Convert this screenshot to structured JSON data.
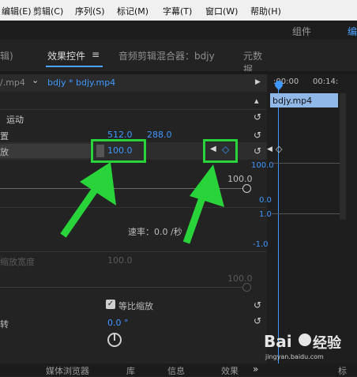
{
  "menu": {
    "items": [
      "编辑(E)",
      "剪辑(C)",
      "序列(S)",
      "标记(M)",
      "字幕(T)",
      "窗口(W)",
      "帮助(H)"
    ]
  },
  "topbar": {
    "component": "组件",
    "edit": "编"
  },
  "panel_tabs": {
    "tab_edge": "辑)",
    "effects_label": "效果控件",
    "menu_icon_glyph": "≡",
    "audio_mixer_label": "音频剪辑混合器：bdjy",
    "metadata_label": "元数据"
  },
  "clipbar": {
    "left_clip": "/.mp4",
    "dropdown_glyph": "⌄",
    "sequence_clip": "bdjy * bdjy.mp4",
    "play_glyph": "▶"
  },
  "timeline": {
    "time_start": ":00:00",
    "time_end": "00:14:",
    "clip_label": "bdjy.mp4",
    "scale_top": "100.0",
    "scale_mid": "0.0",
    "speed_top": "1.0",
    "speed_bottom": "-1.0"
  },
  "effects": {
    "motion_label": "运动",
    "position_label": "置",
    "position_x": "512.0",
    "position_y": "288.0",
    "scale_label": "放",
    "scale_value": "100.0",
    "slider_max": "100.0",
    "velocity_label": "速率：0.0 /秒",
    "scale_width_label": "缩放宽度",
    "scale_width_value": "100.0",
    "scale_width_max": "100.0",
    "uniform_scale_label": "等比缩放",
    "rotation_label": "转",
    "rotation_value": "0.0 °",
    "collapse_glyph": "▴",
    "keyframe_prev_glyph": "◀",
    "keyframe_diamond_glyph": "◇",
    "reset_glyph": "↺",
    "check_glyph": "✓"
  },
  "bottom": {
    "media_browser": "媒体浏览器",
    "library": "库",
    "info": "信息",
    "effects": "效果",
    "more_glyph": "»",
    "last": "标"
  },
  "watermark": {
    "brand": "Bai",
    "brand_cn": "经验",
    "url": "jingyan.baidu.com"
  },
  "colors": {
    "accent_blue": "#3f98ff",
    "annotation_green": "#28d43a",
    "clip_blue": "#8fb8e8"
  }
}
